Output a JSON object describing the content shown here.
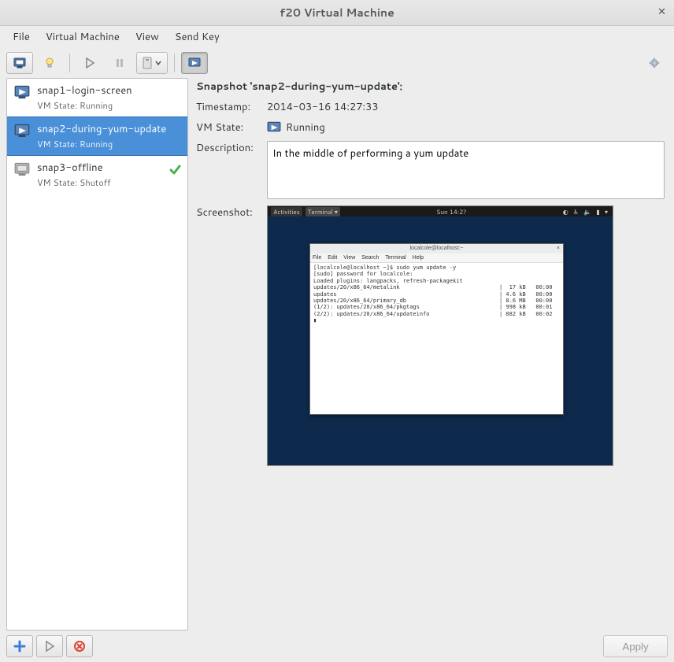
{
  "window": {
    "title": "f20 Virtual Machine"
  },
  "menubar": {
    "file": "File",
    "virtual_machine": "Virtual Machine",
    "view": "View",
    "send_key": "Send Key"
  },
  "toolbar": {
    "console": "console",
    "lightbulb": "lightbulb",
    "run": "run",
    "pause": "pause",
    "shutdown": "shutdown",
    "snapshots": "snapshots",
    "fullscreen": "fullscreen"
  },
  "snapshots": [
    {
      "name": "snap1-login-screen",
      "state_label": "VM State: Running",
      "running": true,
      "current": false
    },
    {
      "name": "snap2-during-yum-update",
      "state_label": "VM State: Running",
      "running": true,
      "current": false
    },
    {
      "name": "snap3-offline",
      "state_label": "VM State: Shutoff",
      "running": false,
      "current": true
    }
  ],
  "selected_index": 1,
  "details": {
    "title": "Snapshot 'snap2-during-yum-update':",
    "timestamp_label": "Timestamp:",
    "timestamp_value": "2014-03-16 14:27:33",
    "vmstate_label": "VM State:",
    "vmstate_value": "Running",
    "description_label": "Description:",
    "description_value": "In the middle of performing a yum update",
    "screenshot_label": "Screenshot:"
  },
  "guest_screenshot": {
    "topbar_activities": "Activities",
    "topbar_app": "Terminal ▾",
    "topbar_clock": "Sun 14:2?",
    "terminal_title": "localcole@localhost:~",
    "terminal_menu": [
      "File",
      "Edit",
      "View",
      "Search",
      "Terminal",
      "Help"
    ],
    "terminal_lines": [
      "[localcole@localhost ~]$ sudo yum update -y",
      "[sudo] password for localcole:",
      "Loaded plugins: langpacks, refresh-packagekit",
      "updates/20/x86_64/metalink                              |  17 kB   00:00",
      "updates                                                 | 4.6 kB   00:00",
      "updates/20/x86_64/primary_db                            | 8.6 MB   00:00",
      "(1/2): updates/20/x86_64/pkgtags                        | 998 kB   00:01",
      "(2/2): updates/20/x86_64/updateinfo                     | 882 kB   00:02",
      "▮"
    ]
  },
  "bottombar": {
    "add": "add",
    "run": "run",
    "delete": "delete",
    "apply": "Apply"
  }
}
